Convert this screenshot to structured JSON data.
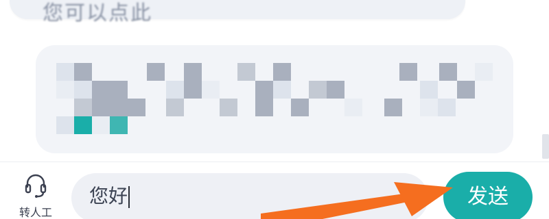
{
  "chat": {
    "top_bubble_text": "您可以点此"
  },
  "mosaic": {
    "colors": {
      "dark": "#a9b0be",
      "mid": "#c3c9d3",
      "light": "#dde3ec",
      "faint": "#e9edf3",
      "teal": "#1aaea9",
      "teal_soft": "#3fb6b2"
    }
  },
  "input_bar": {
    "transfer_label": "转人工",
    "transfer_icon": "headset-icon",
    "message_value": "您好",
    "send_label": "发送"
  },
  "annotation": {
    "arrow_color": "#f56e1f",
    "arrow_target": "send-button"
  }
}
